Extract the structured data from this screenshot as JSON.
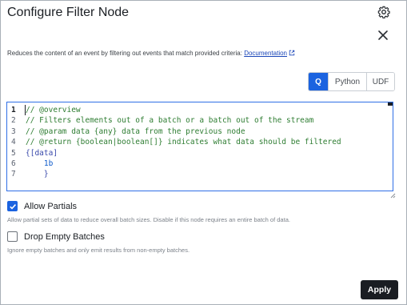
{
  "dialog": {
    "title": "Configure Filter Node",
    "settings_icon": "gear-icon",
    "close_icon": "close-icon"
  },
  "description": {
    "text": "Reduces the content of an event by filtering out events that match provided criteria:",
    "link_label": "Documentation",
    "link_icon": "external-link-icon"
  },
  "language_tabs": [
    {
      "label": "Q",
      "active": true
    },
    {
      "label": "Python",
      "active": false
    },
    {
      "label": "UDF",
      "active": false
    }
  ],
  "editor": {
    "line_numbers": [
      "1",
      "2",
      "3",
      "4",
      "5",
      "6",
      "7"
    ],
    "lines": [
      "// @overview",
      "// Filters elements out of a batch or a batch out of the stream",
      "// @param data {any} data from the previous node",
      "// @return {boolean|boolean[]} indicates what data should be filtered",
      "{[data]",
      "    1b",
      "    }"
    ]
  },
  "options": {
    "allow_partials": {
      "label": "Allow Partials",
      "checked": true,
      "hint": "Allow partial sets of data to reduce overall batch sizes. Disable if this node requires an entire batch of data."
    },
    "drop_empty_batches": {
      "label": "Drop Empty Batches",
      "checked": false,
      "hint": "Ignore empty batches and only emit results from non-empty batches."
    }
  },
  "footer": {
    "apply_label": "Apply"
  },
  "colors": {
    "accent": "#1b63e0",
    "apply_bg": "#1a1d22",
    "comment": "#2e7d32",
    "editor_border": "#2f6fe6"
  }
}
